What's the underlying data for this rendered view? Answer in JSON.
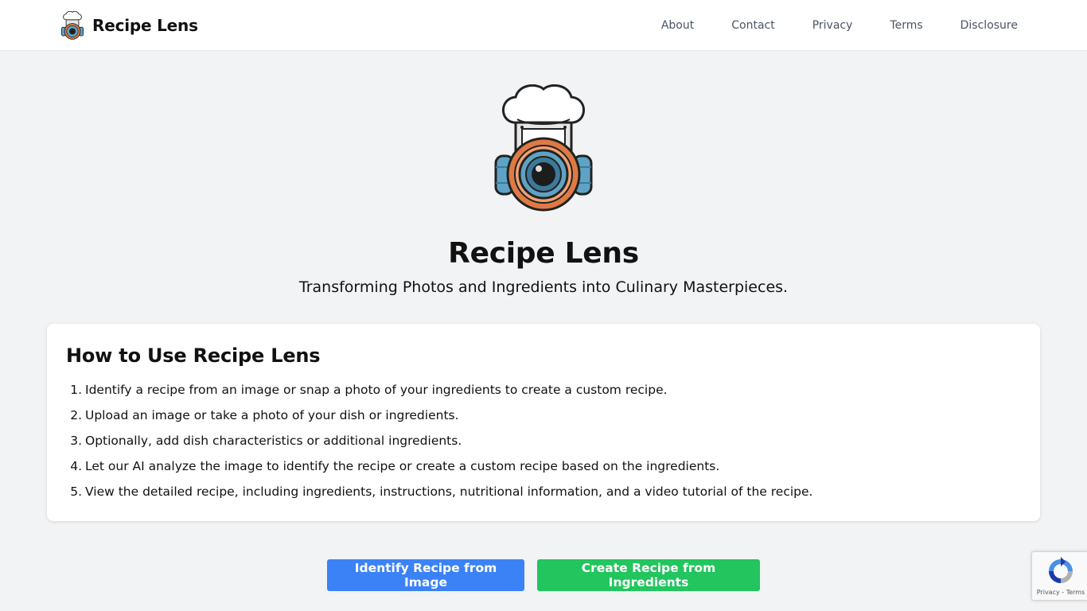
{
  "header": {
    "brand_name": "Recipe Lens",
    "nav": [
      {
        "label": "About"
      },
      {
        "label": "Contact"
      },
      {
        "label": "Privacy"
      },
      {
        "label": "Terms"
      },
      {
        "label": "Disclosure"
      }
    ]
  },
  "hero": {
    "title": "Recipe Lens",
    "subtitle": "Transforming Photos and Ingredients into Culinary Masterpieces.",
    "logo_icon": "chef-camera-icon"
  },
  "instructions": {
    "title": "How to Use Recipe Lens",
    "steps": [
      {
        "num": "1.",
        "text": "Identify a recipe from an image or snap a photo of your ingredients to create a custom recipe."
      },
      {
        "num": "2.",
        "text": "Upload an image or take a photo of your dish or ingredients."
      },
      {
        "num": "3.",
        "text": "Optionally, add dish characteristics or additional ingredients."
      },
      {
        "num": "4.",
        "text": "Let our AI analyze the image to identify the recipe or create a custom recipe based on the ingredients."
      },
      {
        "num": "5.",
        "text": "View the detailed recipe, including ingredients, instructions, nutritional information, and a video tutorial of the recipe."
      }
    ]
  },
  "actions": {
    "identify_label": "Identify Recipe from Image",
    "create_label": "Create Recipe from Ingredients"
  },
  "recaptcha": {
    "links": "Privacy - Terms"
  },
  "colors": {
    "background": "#f2f3f5",
    "identify_button": "#3b82f6",
    "create_button": "#22c55e",
    "logo_orange": "#e07a45",
    "logo_blue": "#5fa3c4"
  }
}
